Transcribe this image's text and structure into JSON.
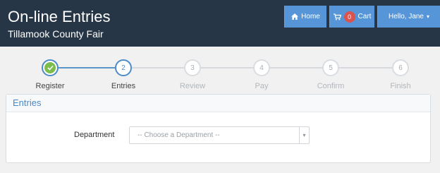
{
  "header": {
    "title": "On-line Entries",
    "subtitle": "Tillamook County Fair"
  },
  "nav": {
    "home_label": "Home",
    "cart_count": "0",
    "cart_label": "Cart",
    "user_label": "Hello, Jane",
    "accent_color": "#5696d8",
    "icons": [
      "home-icon",
      "cart-icon",
      "chevron-down-icon"
    ]
  },
  "steps": [
    {
      "number": "1",
      "label": "Register",
      "state": "done"
    },
    {
      "number": "2",
      "label": "Entries",
      "state": "active"
    },
    {
      "number": "3",
      "label": "Review",
      "state": "pending"
    },
    {
      "number": "4",
      "label": "Pay",
      "state": "pending"
    },
    {
      "number": "5",
      "label": "Confirm",
      "state": "pending"
    },
    {
      "number": "6",
      "label": "Finish",
      "state": "pending"
    }
  ],
  "panel": {
    "title": "Entries",
    "department_label": "Department",
    "department_placeholder": "-- Choose a Department --"
  },
  "colors": {
    "header_bg": "#273646",
    "step_active": "#4c8bc8",
    "step_done_check": "#7cbe4c",
    "badge": "#d9534f"
  }
}
